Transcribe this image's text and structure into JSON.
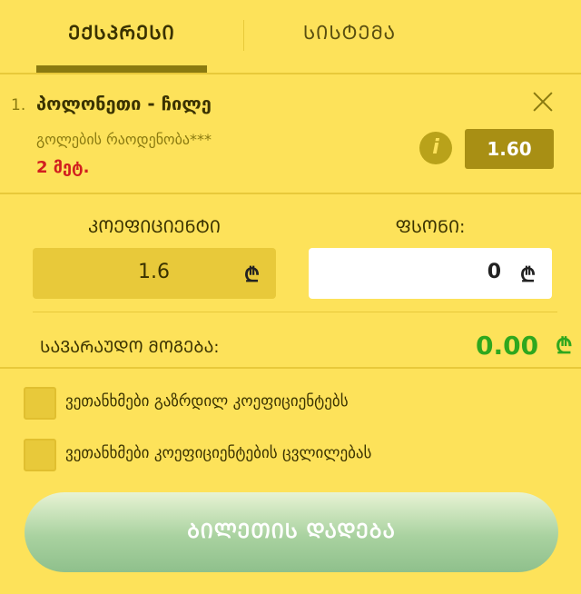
{
  "tabs": {
    "express": "ᲔᲥᲡᲞᲠᲔᲡᲘ",
    "system": "ᲡᲘᲡᲢᲔᲛᲐ"
  },
  "bet": {
    "number": "1.",
    "match": "პოლონეთი - ჩილე",
    "market": "გოლების რაოდენობა***",
    "selection": "2 მეტ.",
    "odd": "1.60",
    "info_icon": "i"
  },
  "form": {
    "coef_label": "ᲙᲝᲔᲤᲘᲪᲘᲔᲜᲢᲘ",
    "stake_label": "ᲤᲡᲝᲜᲘ:",
    "coef_value": "1.6",
    "stake_value": "0",
    "currency": "₾"
  },
  "win": {
    "label": "ᲡᲐᲕᲐᲠᲐᲣᲓᲝ ᲛᲝᲒᲔᲑᲐ:",
    "value": "0.00",
    "currency": "₾"
  },
  "options": [
    {
      "label": "ვეთანხმები გაზრდილ კოეფიციენტებს",
      "checked": false
    },
    {
      "label": "ვეთანხმები კოეფიციენტების ცვლილებას",
      "checked": false
    }
  ],
  "place_button": "ᲑᲘᲚᲔᲗᲘᲡ ᲓᲐᲓᲔᲑᲐ",
  "colors": {
    "background": "#fde25a",
    "accent": "#a88f14",
    "win": "#2fa71e",
    "selection": "#d11f1f"
  }
}
